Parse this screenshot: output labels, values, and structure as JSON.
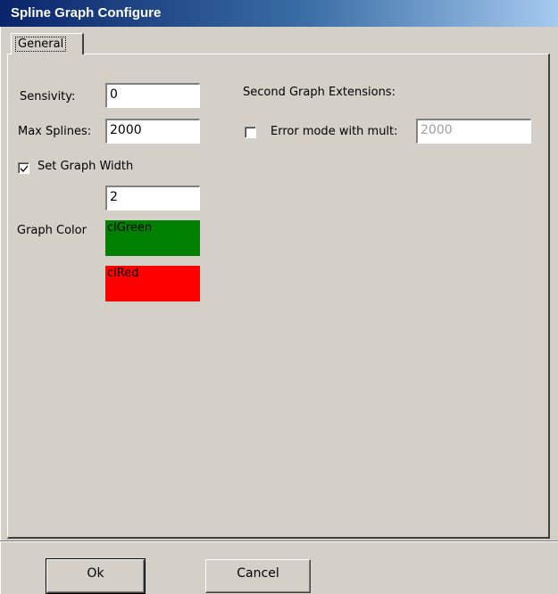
{
  "window": {
    "title": "Spline Graph Configure"
  },
  "tabs": [
    {
      "label": "General"
    }
  ],
  "general": {
    "sensitivity_label": "Sensivity:",
    "sensitivity_value": "0",
    "max_splines_label": "Max Splines:",
    "max_splines_value": "2000",
    "set_graph_width_label": "Set Graph Width",
    "set_graph_width_checked": true,
    "graph_width_value": "2",
    "graph_color_label": "Graph Color",
    "colors": [
      {
        "name": "clGreen",
        "hex": "#008000"
      },
      {
        "name": "clRed",
        "hex": "#ff0000"
      }
    ]
  },
  "second_graph": {
    "heading": "Second Graph Extensions:",
    "error_mode_label": "Error mode with mult:",
    "error_mode_checked": false,
    "error_mult_value": "2000"
  },
  "buttons": {
    "ok_label": "Ok",
    "cancel_label": "Cancel"
  }
}
